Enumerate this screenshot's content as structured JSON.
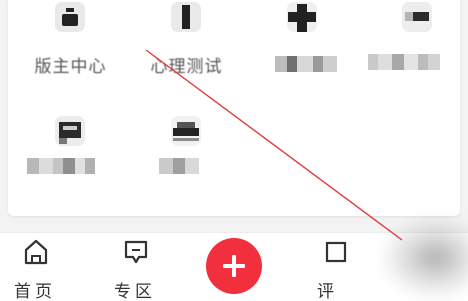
{
  "grid": {
    "items": [
      {
        "label": "版主中心",
        "icon": "pot-icon"
      },
      {
        "label": "心理测试",
        "icon": "bar-icon"
      },
      {
        "label": "",
        "icon": "cross-icon"
      },
      {
        "label": "",
        "icon": "dash-icon"
      },
      {
        "label": "",
        "icon": "certificate-icon"
      },
      {
        "label": "",
        "icon": "boat-icon"
      }
    ]
  },
  "bottom_nav": {
    "items": [
      {
        "label": "首页",
        "icon": "home-icon"
      },
      {
        "label": "专区",
        "icon": "chat-icon"
      },
      {
        "label": "评",
        "icon": "square-icon"
      }
    ],
    "add_button_icon": "plus-icon"
  },
  "colors": {
    "accent": "#f2303d",
    "annotation_line": "#e23a3a"
  }
}
